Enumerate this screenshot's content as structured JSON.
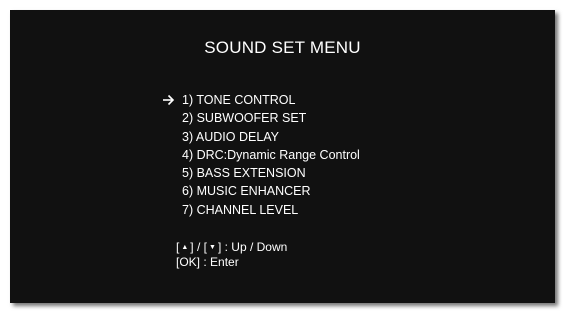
{
  "screen": {
    "title": "SOUND SET MENU"
  },
  "menu": {
    "selected_index": 0,
    "items": [
      {
        "label": "1) TONE CONTROL"
      },
      {
        "label": "2) SUBWOOFER SET"
      },
      {
        "label": "3) AUDIO DELAY"
      },
      {
        "label": "4) DRC:Dynamic Range Control"
      },
      {
        "label": "5) BASS EXTENSION"
      },
      {
        "label": "6) MUSIC ENHANCER"
      },
      {
        "label": "7) CHANNEL LEVEL"
      }
    ]
  },
  "help": {
    "up_key_symbol": "▲",
    "down_key_symbol": "▼",
    "nav_text": ":  Up / Down",
    "ok_key": "[OK]",
    "ok_text": " :  Enter"
  },
  "icons": {
    "cursor": "arrow-right-icon"
  },
  "colors": {
    "background": "#111111",
    "text": "#ffffff"
  }
}
